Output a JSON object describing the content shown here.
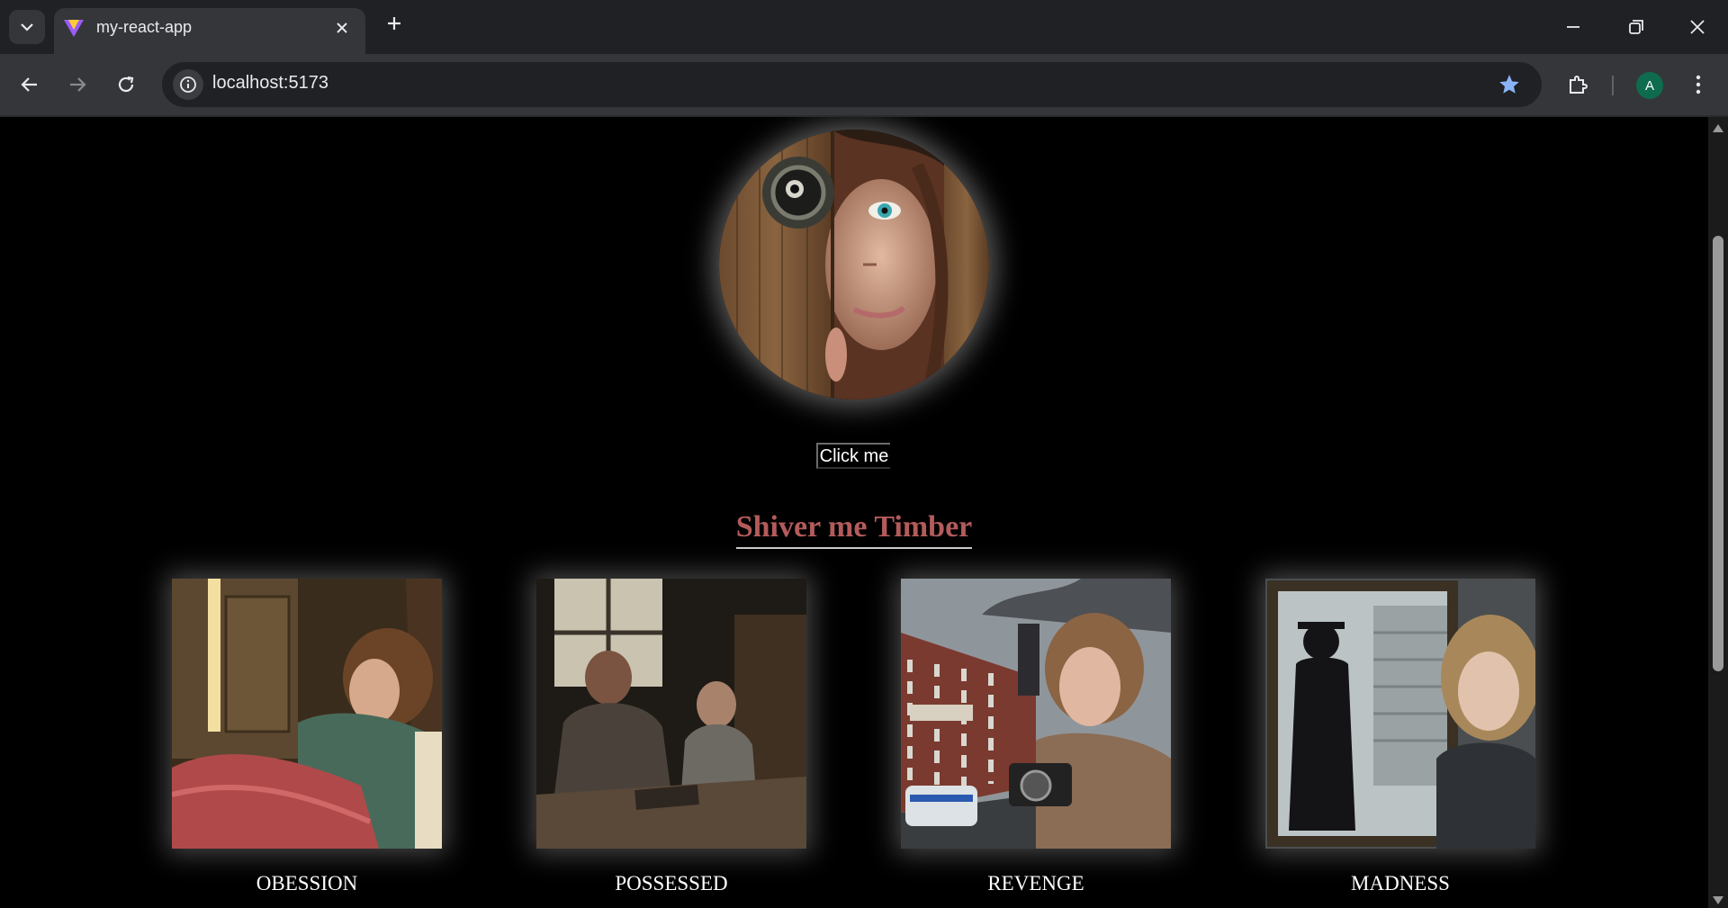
{
  "browser": {
    "tab_title": "my-react-app",
    "url": "localhost:5173",
    "profile_initial": "A"
  },
  "page": {
    "button_label": "Click me",
    "heading": "Shiver me Timber",
    "cards": [
      {
        "caption": "OBESSION"
      },
      {
        "caption": "POSSESSED"
      },
      {
        "caption": "REVENGE"
      },
      {
        "caption": "MADNESS"
      }
    ]
  },
  "colors": {
    "heading": "#b35b5b",
    "page_background": "#000000",
    "chrome_dark": "#202124",
    "chrome_toolbar": "#35363a",
    "star": "#8ab4f8"
  },
  "icons": [
    "tab-list-icon",
    "vite-favicon-icon",
    "close-tab-icon",
    "new-tab-icon",
    "minimize-icon",
    "restore-icon",
    "close-window-icon",
    "back-icon",
    "forward-icon",
    "reload-icon",
    "site-info-icon",
    "bookmark-star-icon",
    "extensions-icon",
    "more-menu-icon"
  ]
}
